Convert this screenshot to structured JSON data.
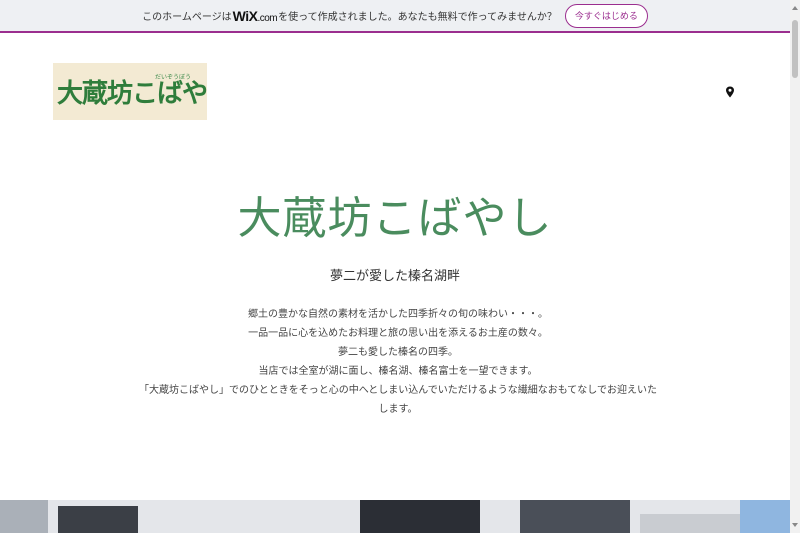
{
  "wix_banner": {
    "text_before": "このホームページは",
    "brand": "WiX",
    "brand_suffix": ".com",
    "text_after": "を使って作成されました。あなたも無料で作ってみませんか？",
    "cta_label": "今すぐはじめる"
  },
  "header": {
    "logo_ruby": "だいぞうぼう",
    "logo_text": "大蔵坊こばやし",
    "location_icon": "map-pin-icon"
  },
  "hero": {
    "title": "大蔵坊こばやし",
    "subtitle": "夢二が愛した榛名湖畔",
    "paragraphs": [
      "郷土の豊かな自然の素材を活かした四季折々の旬の味わい・・・。",
      "一品一品に心を込めたお料理と旅の思い出を添えるお土産の数々。",
      "夢二も愛した榛名の四季。",
      "当店では全室が湖に面し、榛名湖、榛名富士を一望できます。",
      "「大蔵坊こばやし」でのひとときをそっと心の中へとしまい込んでいただけるような繊細なおもてなしでお迎えいたします。"
    ]
  },
  "colors": {
    "wix_accent": "#9b2e8f",
    "title_green": "#4a8c5e",
    "logo_green": "#2f7d3b"
  }
}
